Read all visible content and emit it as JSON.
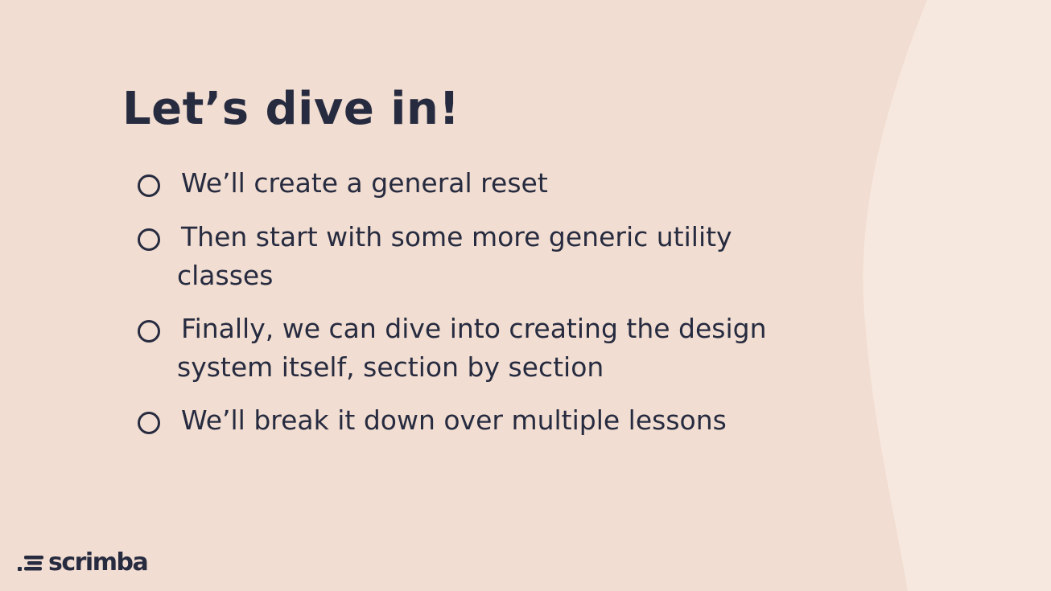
{
  "slide": {
    "title": "Let’s dive in!",
    "bullets": [
      "We’ll create a general reset",
      "Then start with some more generic utility classes",
      "Finally, we can dive into creating the design system itself, section by section",
      "We’ll break it down over multiple lessons"
    ]
  },
  "logo": {
    "wordmark": "scrimba"
  },
  "colors": {
    "background": "#f1ddd1",
    "background_light": "#f7e8df",
    "text": "#272b40"
  },
  "icons": {
    "bullet_marker": "hollow-circle-icon",
    "logo_mark": "scrimba-logo-icon"
  }
}
